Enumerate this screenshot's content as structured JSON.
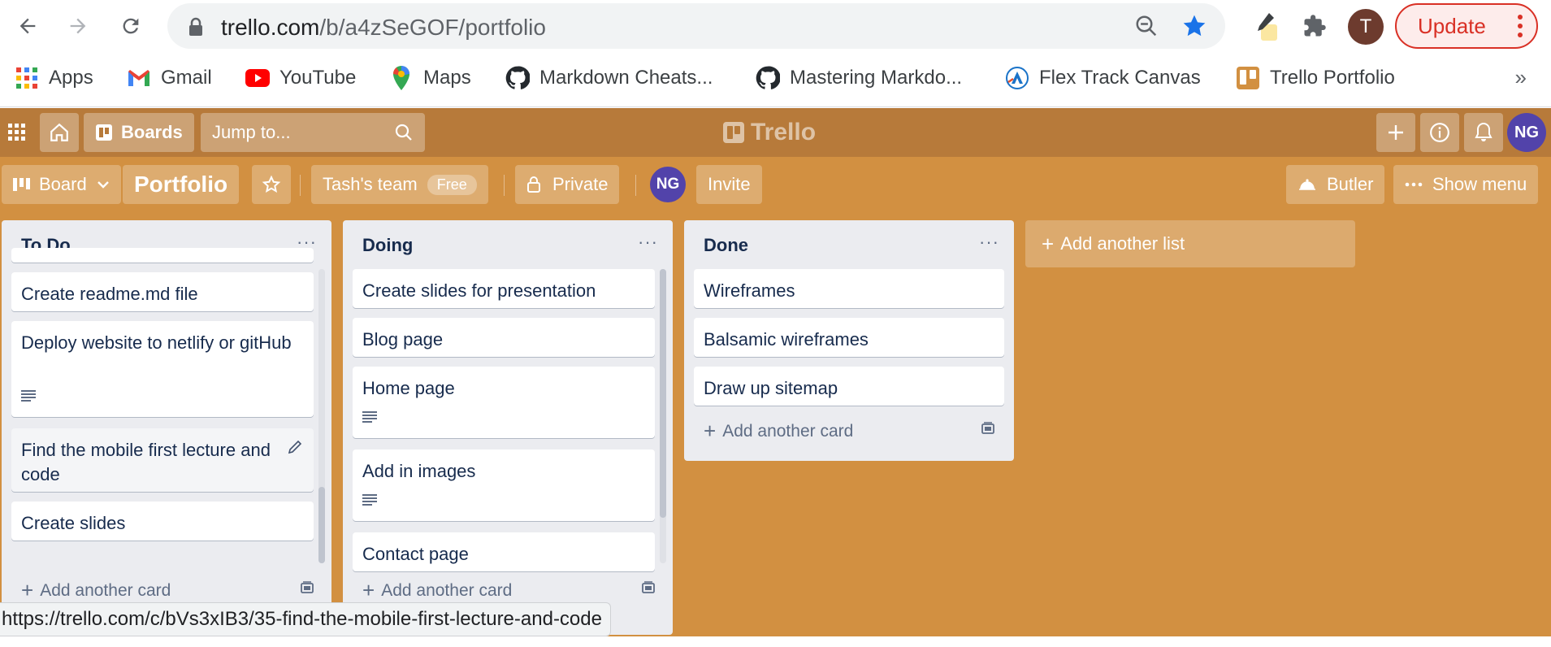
{
  "browser": {
    "url_host": "trello.com",
    "url_path": "/b/a4zSeGOF/portfolio",
    "profile_initial": "T",
    "update_label": "Update",
    "bookmarks": [
      {
        "label": "Apps",
        "icon": "apps-grid-icon"
      },
      {
        "label": "Gmail",
        "icon": "gmail-icon"
      },
      {
        "label": "YouTube",
        "icon": "youtube-icon"
      },
      {
        "label": "Maps",
        "icon": "maps-icon"
      },
      {
        "label": "Markdown Cheats...",
        "icon": "github-icon"
      },
      {
        "label": "Mastering Markdo...",
        "icon": "github-icon"
      },
      {
        "label": "Flex Track Canvas",
        "icon": "canvas-icon"
      },
      {
        "label": "Trello Portfolio",
        "icon": "trello-icon"
      }
    ],
    "bookmarks_more": "»",
    "status_url": "https://trello.com/c/bVs3xIB3/35-find-the-mobile-first-lecture-and-code"
  },
  "header": {
    "boards_label": "Boards",
    "jump_placeholder": "Jump to...",
    "logo_text": "Trello",
    "avatar_initials": "NG"
  },
  "board_bar": {
    "view_label": "Board",
    "board_title": "Portfolio",
    "team_label": "Tash's team",
    "team_badge": "Free",
    "visibility_label": "Private",
    "member_initials": "NG",
    "invite_label": "Invite",
    "butler_label": "Butler",
    "show_menu_label": "Show menu"
  },
  "lists": [
    {
      "title": "To Do",
      "menu": "···",
      "add_card_label": "Add another card",
      "cards": [
        {
          "text": ""
        },
        {
          "text": "Create readme.md file"
        },
        {
          "text": "Deploy website to netlify or gitHub"
        },
        {
          "text": "Find the mobile first lecture and code"
        },
        {
          "text": "Create slides"
        }
      ]
    },
    {
      "title": "Doing",
      "menu": "···",
      "add_card_label": "Add another card",
      "cards": [
        {
          "text": "Create slides for presentation"
        },
        {
          "text": "Blog page"
        },
        {
          "text": "Home page"
        },
        {
          "text": "Add in images"
        },
        {
          "text": "Contact page"
        }
      ]
    },
    {
      "title": "Done",
      "menu": "···",
      "add_card_label": "Add another card",
      "cards": [
        {
          "text": "Wireframes"
        },
        {
          "text": "Balsamic wireframes"
        },
        {
          "text": "Draw up sitemap"
        }
      ]
    }
  ],
  "add_list_label": "Add another list",
  "colors": {
    "board_bg": "#d29041",
    "header_bg": "#b77a3a",
    "avatar": "#5243aa",
    "update_red": "#d93025",
    "star_blue": "#1a73e8"
  }
}
